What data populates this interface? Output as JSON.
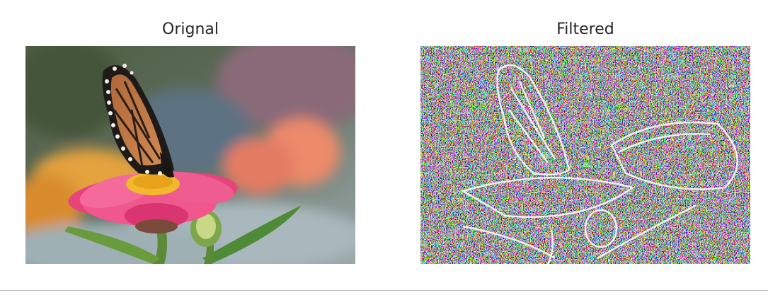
{
  "panels": [
    {
      "title": "Orignal",
      "image": "butterfly-on-pink-zinnia-photo"
    },
    {
      "title": "Filtered",
      "image": "edge-filtered-butterfly-noise-image"
    }
  ],
  "colors": {
    "background": "#ffffff",
    "divider": "#bdbdbd",
    "title_text": "#262626"
  }
}
